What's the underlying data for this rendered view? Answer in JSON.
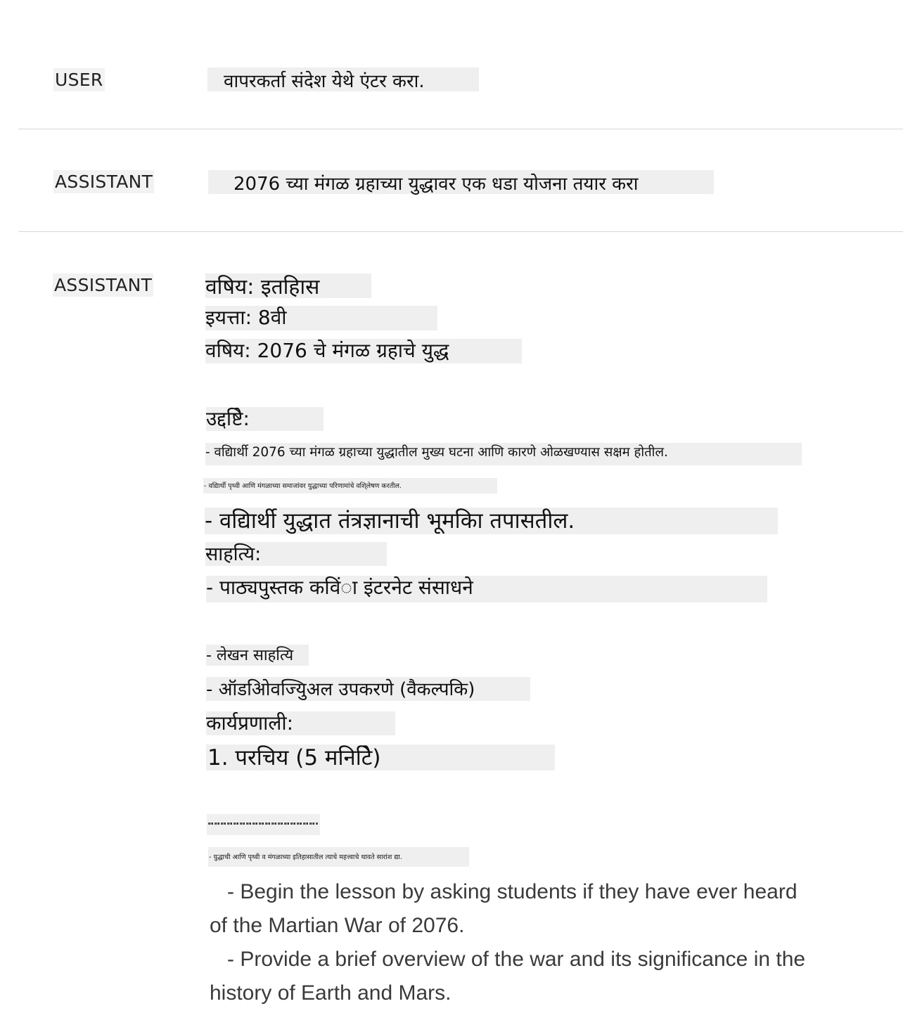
{
  "messages": [
    {
      "role": "USER",
      "text": "वापरकर्ता संदेश येथे एंटर करा."
    },
    {
      "role": "ASSISTANT",
      "text": "2076 च्या मंगळ ग्रहाच्या युद्धावर एक धडा योजना तयार करा"
    },
    {
      "role": "ASSISTANT",
      "lines": [
        "वषिय: इतहिास",
        "इयत्ता: 8वी",
        "वषिय: 2076 चे मंगळ ग्रहाचे युद्ध",
        "उद्दष्टिे:",
        "- वद्यिार्थी 2076 च्या मंगळ ग्रहाच्या युद्धातील मुख्य घटना आणि कारणे ओळखण्यास सक्षम होतील.",
        "- वद्यिार्थी पृथ्वी आणि मंगळाच्या समाजांवर युद्धाच्या परिणामांचे वशि्लेषण करतील.",
        "- वद्यिार्थी युद्धात तंत्रज्ञानाची भूमकिा तपासतील.",
        "साहत्यि:",
        "- पाठ्यपुस्तक कविंा इंटरनेट संसाधने",
        "- लेखन साहत्यि",
        "- ऑडओिवज्यिुअल उपकरणे (वैकल्पकि)",
        "कार्यप्रणाली:",
        "1. परचिय (5 मनिटिे)",
        "- युद्धाची आणि पृथ्वी व मंगळाच्या इतिहासातील त्याचे महत्त्वाचे थावते सारांश द्या."
      ],
      "english": [
        "   - Begin the lesson by asking students if they have ever heard of the Martian War of 2076.",
        "   - Provide a brief overview of the war and its significance in the history of Earth and Mars."
      ]
    }
  ]
}
